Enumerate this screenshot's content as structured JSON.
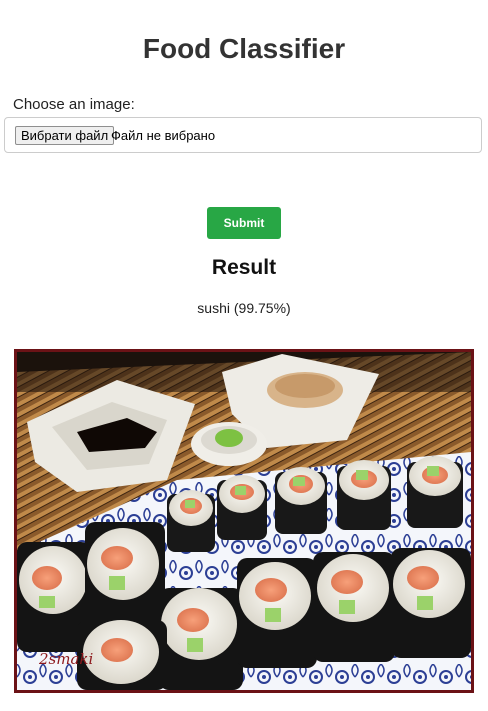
{
  "header": {
    "title": "Food Classifier"
  },
  "upload": {
    "label": "Choose an image:",
    "button_label": "Вибрати файл",
    "status_text": "Файл не вибрано"
  },
  "actions": {
    "submit_label": "Submit",
    "submit_color": "#28a745"
  },
  "result": {
    "heading": "Result",
    "prediction": "sushi (99.75%)"
  },
  "image": {
    "subject": "sushi rolls on a blue-patterned plate",
    "watermark": "2smaki"
  }
}
